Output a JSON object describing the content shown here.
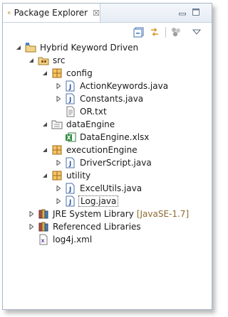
{
  "view": {
    "tab_title": "Package Explorer",
    "tab_close_glyph": "☒"
  },
  "toolbar": {
    "icons": [
      "collapse-all-icon",
      "link-with-editor-icon",
      "focus-on-active-task-icon",
      "view-menu-icon"
    ]
  },
  "tree": {
    "project": {
      "label": "Hybrid Keyword Driven",
      "expanded": true
    },
    "src": {
      "label": "src",
      "expanded": true
    },
    "config": {
      "label": "config",
      "expanded": true
    },
    "action_keywords": {
      "label": "ActionKeywords.java",
      "expanded": false
    },
    "constants": {
      "label": "Constants.java",
      "expanded": false
    },
    "or_txt": {
      "label": "OR.txt"
    },
    "data_engine_folder": {
      "label": "dataEngine",
      "expanded": true
    },
    "data_engine_xlsx": {
      "label": "DataEngine.xlsx"
    },
    "execution_engine": {
      "label": "executionEngine",
      "expanded": true
    },
    "driver_script": {
      "label": "DriverScript.java",
      "expanded": false
    },
    "utility": {
      "label": "utility",
      "expanded": true
    },
    "excel_utils": {
      "label": "ExcelUtils.java",
      "expanded": false
    },
    "log_java": {
      "label": "Log.java",
      "expanded": false,
      "selected": true
    },
    "jre_library": {
      "label": "JRE System Library",
      "decoration": "[JavaSE-1.7]",
      "expanded": false
    },
    "referenced_libraries": {
      "label": "Referenced Libraries",
      "expanded": false
    },
    "log4j_xml": {
      "label": "log4j.xml"
    }
  }
}
